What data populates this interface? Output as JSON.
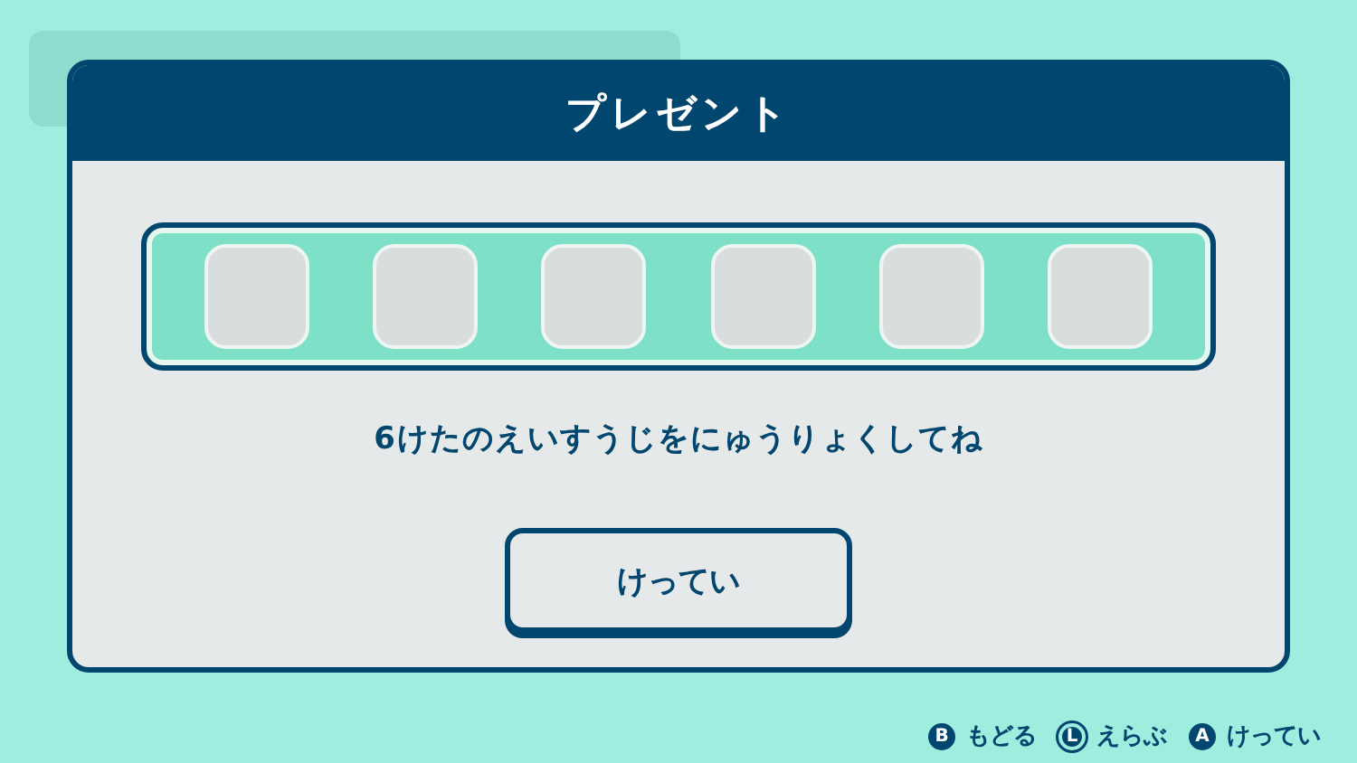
{
  "dialog": {
    "title": "プレゼント",
    "code_slots": [
      {
        "kind": "empty"
      },
      {
        "kind": "empty"
      },
      {
        "kind": "empty"
      },
      {
        "kind": "empty"
      },
      {
        "kind": "empty"
      },
      {
        "kind": "empty"
      }
    ],
    "instruction": "6けたのえいすうじをにゅうりょくしてね",
    "confirm_button": "けってい"
  },
  "hints": [
    {
      "key": "B",
      "kind": "button",
      "label": "もどる"
    },
    {
      "key": "L",
      "kind": "stick",
      "label": "えらぶ"
    },
    {
      "key": "A",
      "kind": "button",
      "label": "けってい"
    }
  ]
}
